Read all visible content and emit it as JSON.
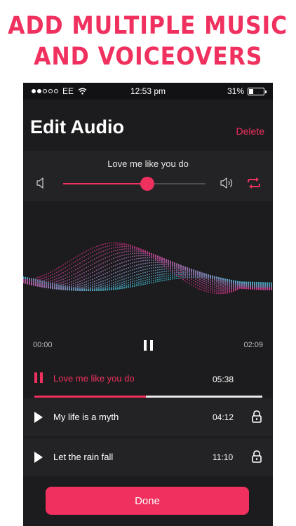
{
  "promo": {
    "line1": "ADD MULTIPLE MUSIC",
    "line2": "AND VOICEOVERS"
  },
  "status_bar": {
    "carrier": "EE",
    "time": "12:53 pm",
    "battery": "31%",
    "battery_level": 0.31,
    "signal_bars_filled": 2,
    "signal_bars_total": 5
  },
  "header": {
    "title": "Edit Audio",
    "delete_label": "Delete"
  },
  "player": {
    "track_name": "Love me like you do",
    "volume_level": 0.59,
    "icons": [
      "volume-low-icon",
      "volume-high-icon",
      "repeat-icon"
    ]
  },
  "waveform": {
    "start_time": "00:00",
    "end_time": "02:09",
    "colors": [
      "#3fd0e6",
      "#e0308a"
    ]
  },
  "tracks": [
    {
      "name": "Love me like you do",
      "duration": "05:38",
      "state": "playing",
      "progress": 0.49
    },
    {
      "name": "My life is a myth",
      "duration": "04:12",
      "state": "stopped",
      "locked": true
    },
    {
      "name": "Let the rain fall",
      "duration": "11:10",
      "state": "stopped",
      "locked": true
    }
  ],
  "done_label": "Done",
  "colors": {
    "accent": "#f0305e",
    "background": "#1c1c1e",
    "row": "#232325"
  }
}
